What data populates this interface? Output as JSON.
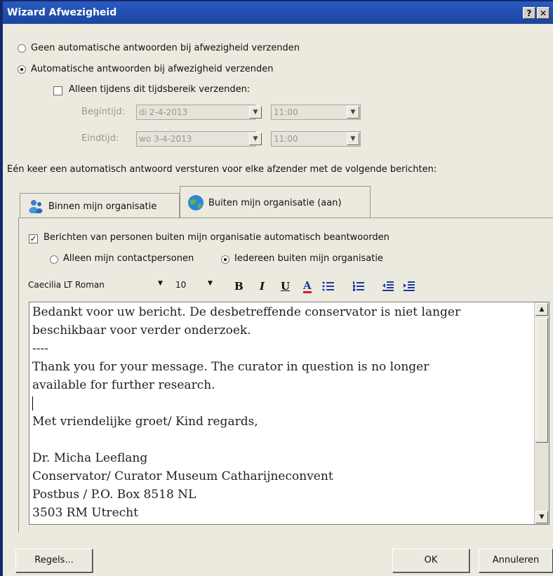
{
  "window": {
    "title": "Wizard Afwezigheid",
    "help_label": "?",
    "close_label": "✕"
  },
  "options": {
    "no_auto": "Geen automatische antwoorden bij afwezigheid verzenden",
    "send_auto": "Automatische antwoorden bij afwezigheid verzenden",
    "time_range": "Alleen tijdens dit tijdsbereik verzenden:"
  },
  "time": {
    "start_label": "Begintijd:",
    "start_date": "di 2-4-2013",
    "start_time": "11:00",
    "end_label": "Eindtijd:",
    "end_date": "wo 3-4-2013",
    "end_time": "11:00"
  },
  "once_text": "Eén keer een automatisch antwoord versturen voor elke afzender met de volgende berichten:",
  "tabs": [
    {
      "label": "Binnen mijn organisatie",
      "icon": "people-icon"
    },
    {
      "label": "Buiten mijn organisatie (aan)",
      "icon": "globe-icon"
    }
  ],
  "outside": {
    "auto_reply": "Berichten van personen buiten mijn organisatie automatisch beantwoorden",
    "contacts_only": "Alleen mijn contactpersonen",
    "everyone": "Iedereen buiten mijn organisatie"
  },
  "toolbar": {
    "font": "Caecilia LT Roman",
    "size": "10",
    "bold": "B",
    "italic": "I",
    "underline": "U",
    "font_color": "A"
  },
  "message": {
    "lines": [
      "Bedankt voor uw bericht. De desbetreffende conservator is niet langer",
      "beschikbaar voor verder onderzoek.",
      "----",
      "Thank you for your message. The curator in question is no longer",
      "available for further research.",
      "",
      "Met vriendelijke groet/ Kind regards,",
      "",
      "Dr. Micha Leeflang",
      "Conservator/ Curator Museum Catharijneconvent",
      "Postbus / P.O. Box 8518 NL",
      "3503 RM Utrecht"
    ]
  },
  "buttons": {
    "rules": "Regels...",
    "ok": "OK",
    "cancel": "Annuleren"
  },
  "colors": {
    "titlebar": "#1a44a0",
    "dialog_bg": "#ece9df",
    "font_color_underline": "#d81e1e"
  }
}
